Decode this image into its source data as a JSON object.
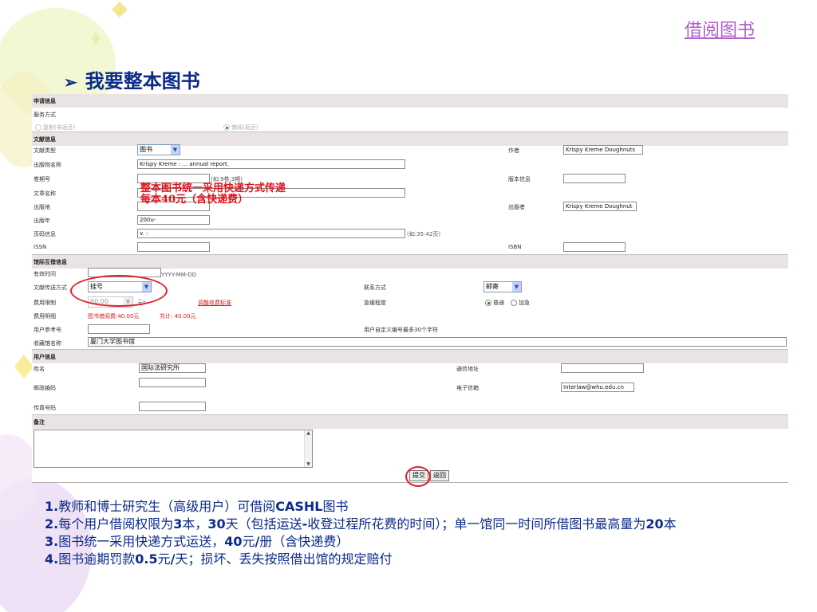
{
  "header": {
    "top_link": "借阅图书",
    "title": "我要整本图书",
    "bullet": "➢"
  },
  "form": {
    "sec_request": "申请信息",
    "service_type_label": "服务方式",
    "service_options": [
      "复制(非返还)",
      "借阅(返还)"
    ],
    "sec_doc": "文献信息",
    "doc_type_label": "文献类型",
    "doc_type_value": "图书",
    "author_label": "作者",
    "author_value": "Krispy Kreme Doughnuts",
    "pub_name_label": "出版物名称",
    "pub_name_value": "Krispy Kreme : ... annual report.",
    "volume_label": "卷期号",
    "volume_hint": "(如:9卷,3期)",
    "edition_label": "版本信息",
    "article_label": "文章名称",
    "place_label": "出版地",
    "publisher_label": "出版者",
    "publisher_value": "Krispy Kreme Doughnut",
    "year_label": "出版年",
    "year_value": "200u-",
    "pages_label": "页码信息",
    "pages_value": "v. :",
    "pages_hint": "(如:35-42页)",
    "issn_label": "ISSN",
    "isbn_label": "ISBN",
    "sec_coop": "馆际互借信息",
    "valid_label": "有效时间",
    "valid_hint": "YYYY-MM-DD",
    "delivery_label": "文献传送方式",
    "delivery_value": "挂号",
    "contact_label": "联系方式",
    "contact_value": "邮寄",
    "fee_limit_label": "费用限制",
    "fee_limit_value": "60.00",
    "fee_unit": "元*",
    "fee_link": "调整收费标准",
    "urgency_label": "急缓程度",
    "urgency_options": [
      "普通",
      "加急"
    ],
    "fee_detail_label": "费用明细",
    "fee_detail_value": "图书借阅费:40.00元",
    "fee_total": "共计: 40.00元",
    "user_ref_label": "用户参考号",
    "user_ref_hint": "用户自定义编号最多30个字符",
    "lib_label": "收藏馆名称",
    "lib_value": "厦门大学图书馆",
    "sec_user": "用户信息",
    "name_label": "姓名",
    "name_value": "国际法研究所",
    "address_label": "通信地址",
    "zip_label": "邮政编码",
    "email_label": "电子信箱",
    "email_value": "Interlaw@whu.edu.cn",
    "fax_label": "传真号码",
    "sec_remark": "备注",
    "submit_label": "提交",
    "back_label": "返回"
  },
  "annotation": {
    "line1": "整本图书统一采用快递方式传递",
    "line2": "每本40元（含快递费）"
  },
  "rules": [
    {
      "num": "1.",
      "text_a": "教师和博士研究生（高级用户）可借阅",
      "bold": "CASHL",
      "text_b": "图书"
    },
    {
      "num": "2.",
      "text_a": "每个用户借阅权限为",
      "bold1": "3",
      "text_b": "本，",
      "bold2": "30",
      "text_c": "天（包括运送",
      "bold3": "-",
      "text_d": "收登过程所花费的时间）；单一馆同一时间所借图书最高量为",
      "bold4": "20",
      "text_e": "本"
    },
    {
      "num": "3.",
      "text_a": "图书统一采用快递方式运送，",
      "bold": "40",
      "text_b": "元",
      "bold2": "/",
      "text_c": "册（含快递费）"
    },
    {
      "num": "4.",
      "text_a": "图书逾期罚款",
      "bold": "0.5",
      "text_b": "元",
      "bold2": "/",
      "text_c": "天；损坏、丢失按照借出馆的规定赔付"
    }
  ],
  "colors": {
    "accent": "#0b2a8a",
    "link": "#b05fc8",
    "annotation": "#e0101a"
  }
}
